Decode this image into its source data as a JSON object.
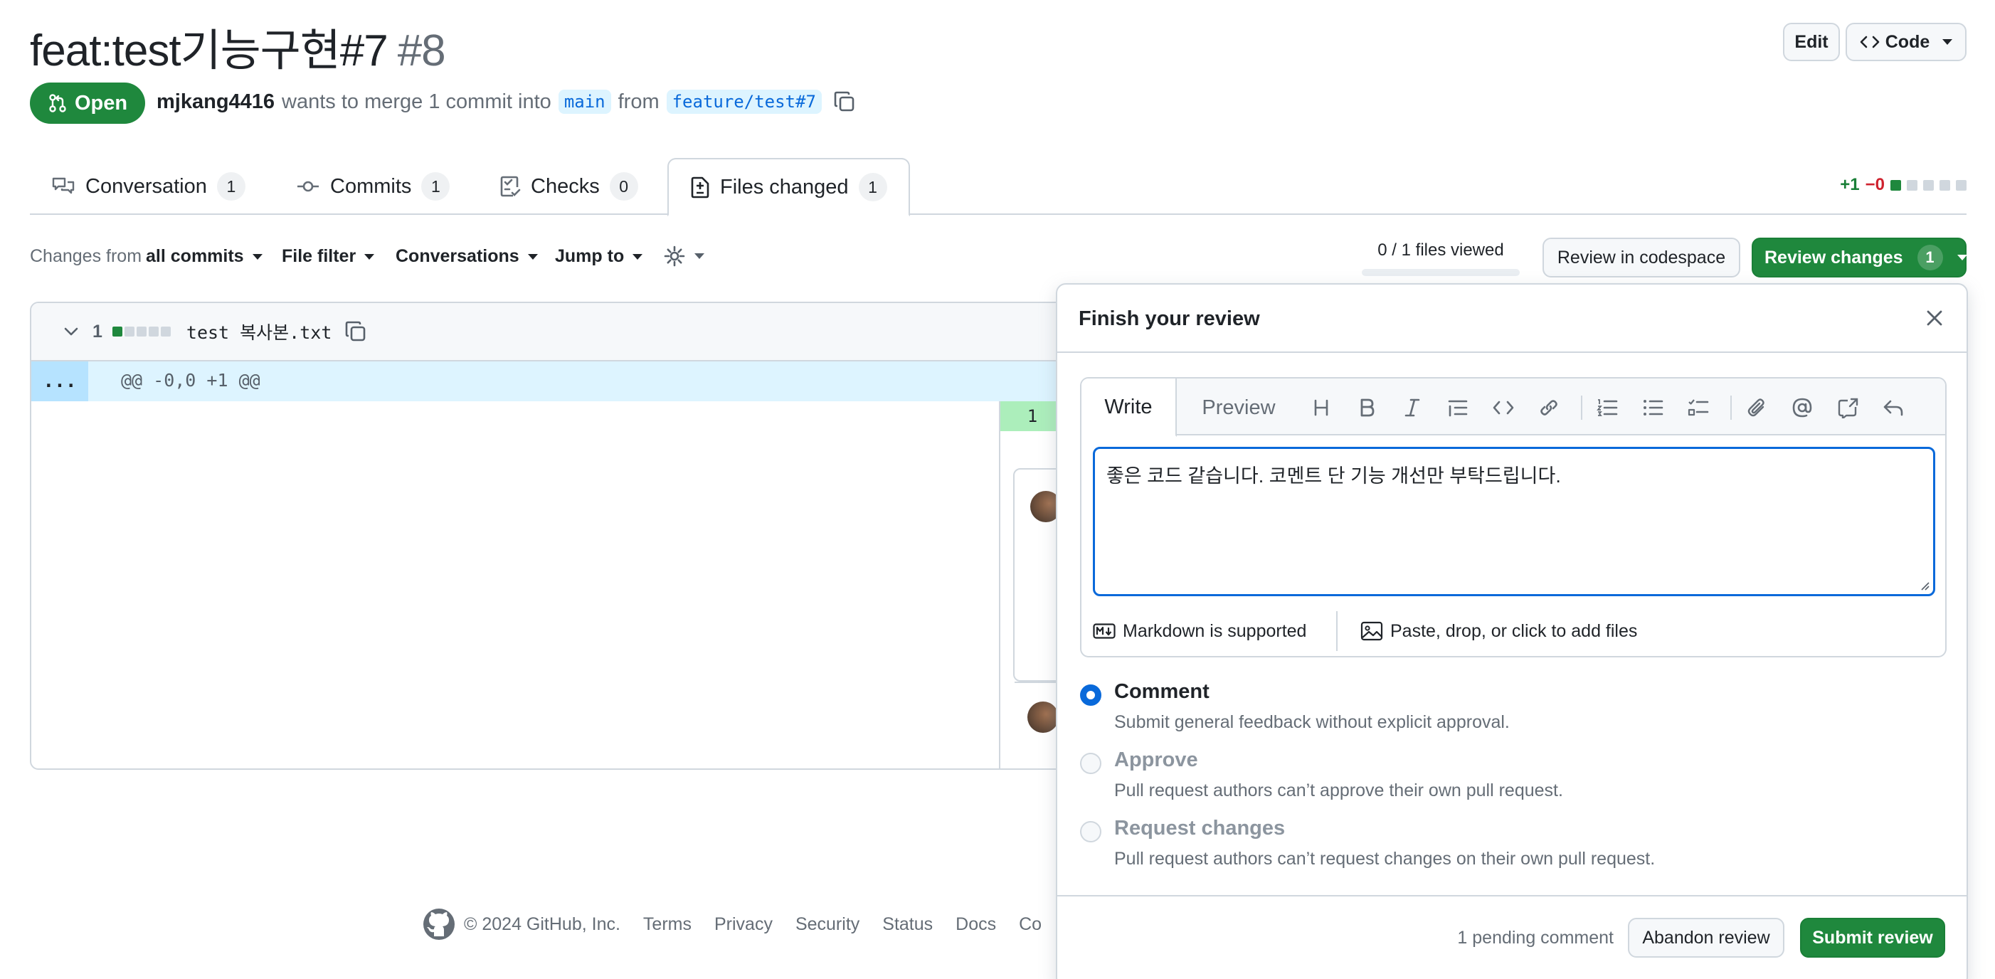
{
  "pr": {
    "title": "feat:test기능구현#7",
    "number": "#8",
    "state": "Open",
    "author": "mjkang4416",
    "merge_text": "wants to merge 1 commit into",
    "base_branch": "main",
    "from_text": "from",
    "head_branch": "feature/test#7"
  },
  "header_actions": {
    "edit": "Edit",
    "code": "Code"
  },
  "tabs": [
    {
      "label": "Conversation",
      "count": "1"
    },
    {
      "label": "Commits",
      "count": "1"
    },
    {
      "label": "Checks",
      "count": "0"
    },
    {
      "label": "Files changed",
      "count": "1"
    }
  ],
  "diffstat": {
    "additions": "+1",
    "deletions": "−0"
  },
  "toolbar": {
    "changes_prefix": "Changes from",
    "changes_value": "all commits",
    "file_filter": "File filter",
    "conversations": "Conversations",
    "jump_to": "Jump to",
    "files_viewed": "0 / 1 files viewed",
    "review_codespace": "Review in codespace",
    "review_changes": "Review changes",
    "review_changes_count": "1"
  },
  "file": {
    "changed_lines": "1",
    "name": "test 복사본.txt",
    "hunk_expand": "...",
    "hunk_header": "@@ -0,0 +1 @@",
    "line_number": "1"
  },
  "review": {
    "title": "Finish your review",
    "tab_write": "Write",
    "tab_preview": "Preview",
    "body": "좋은 코드 같습니다. 코멘트 단 기능 개선만 부탁드립니다.",
    "markdown_note": "Markdown is supported",
    "attach_note": "Paste, drop, or click to add files",
    "options": [
      {
        "label": "Comment",
        "description": "Submit general feedback without explicit approval.",
        "selected": true,
        "disabled": false
      },
      {
        "label": "Approve",
        "description": "Pull request authors can’t approve their own pull request.",
        "selected": false,
        "disabled": true
      },
      {
        "label": "Request changes",
        "description": "Pull request authors can’t request changes on their own pull request.",
        "selected": false,
        "disabled": true
      }
    ],
    "pending": "1 pending comment",
    "abandon": "Abandon review",
    "submit": "Submit review"
  },
  "footer": {
    "copyright": "© 2024 GitHub, Inc.",
    "links": [
      "Terms",
      "Privacy",
      "Security",
      "Status",
      "Docs",
      "Co"
    ]
  },
  "colors": {
    "accent": "#0969da",
    "success": "#1f883d",
    "danger": "#cf222e",
    "border": "#d0d7de"
  }
}
